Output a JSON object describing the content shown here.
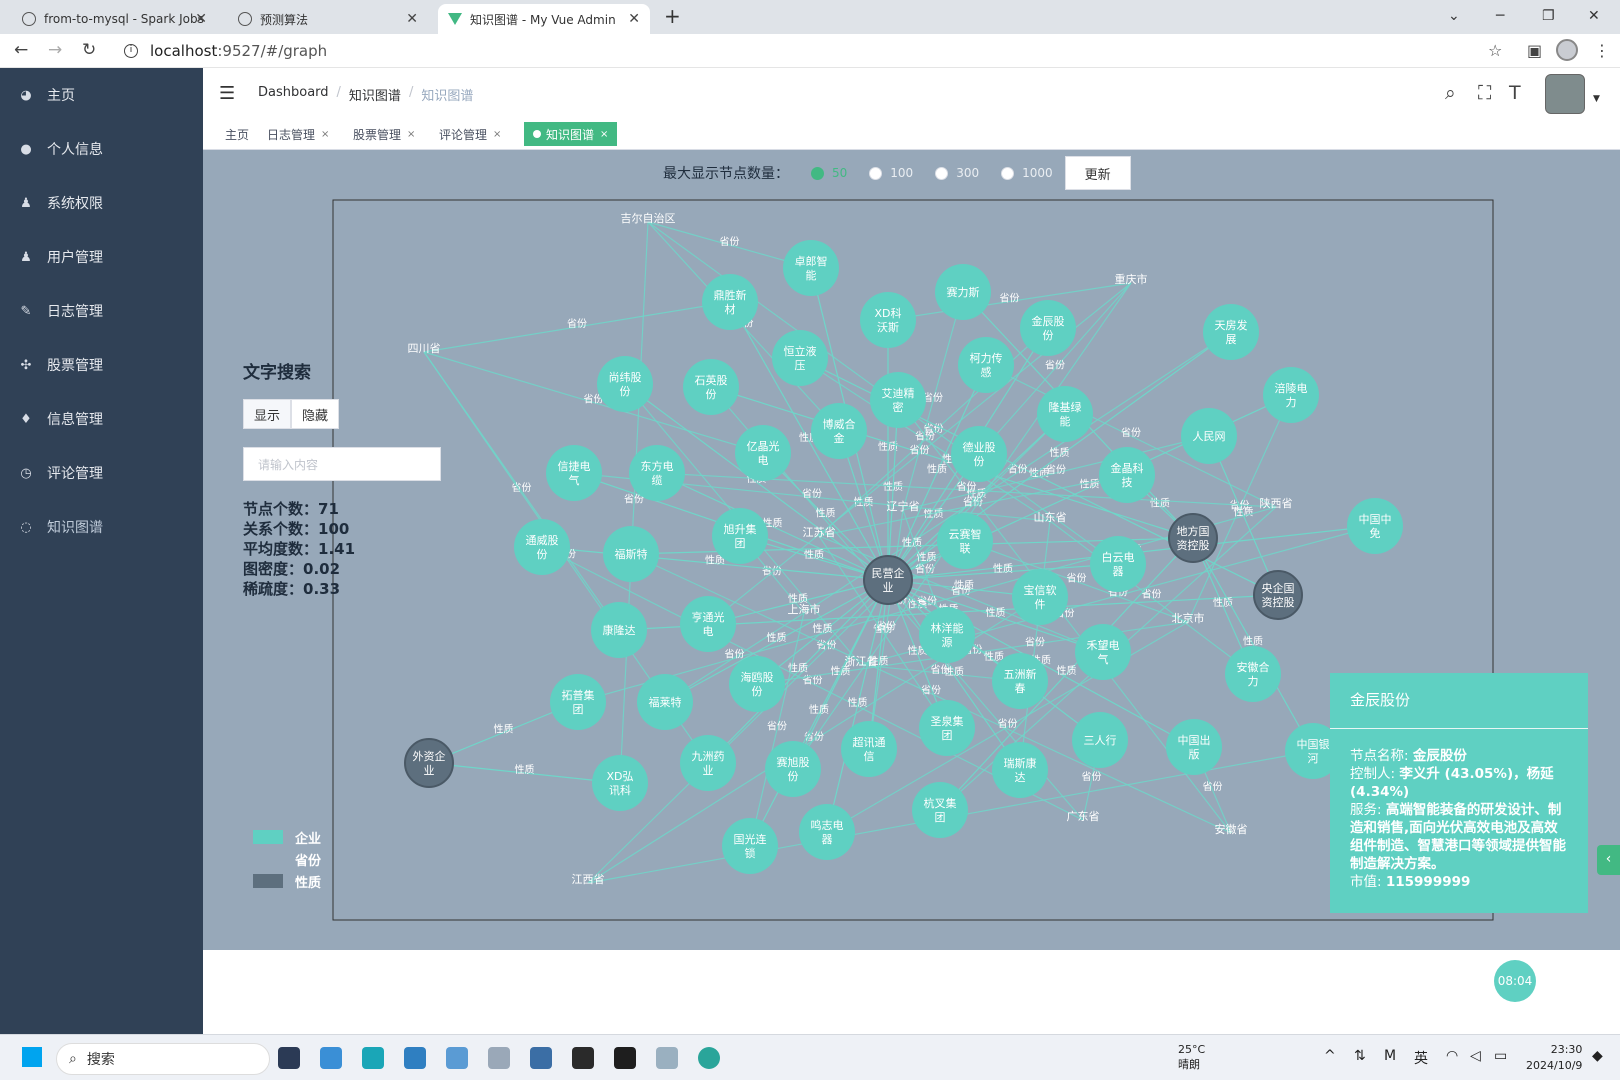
{
  "browser": {
    "tabs": [
      {
        "title": "from-to-mysql - Spark Jobs",
        "active": false
      },
      {
        "title": "预测算法",
        "active": false
      },
      {
        "title": "知识图谱 - My Vue Admin",
        "active": true
      }
    ],
    "url_host": "localhost",
    "url_rest": ":9527/#/graph"
  },
  "sidebar": {
    "items": [
      {
        "label": "主页",
        "icon": "dashboard-icon"
      },
      {
        "label": "个人信息",
        "icon": "user-icon"
      },
      {
        "label": "系统权限",
        "icon": "lock-user-icon"
      },
      {
        "label": "用户管理",
        "icon": "users-icon"
      },
      {
        "label": "日志管理",
        "icon": "pen-icon"
      },
      {
        "label": "股票管理",
        "icon": "move-icon"
      },
      {
        "label": "信息管理",
        "icon": "location-icon"
      },
      {
        "label": "评论管理",
        "icon": "clock-icon"
      },
      {
        "label": "知识图谱",
        "icon": "graph-icon"
      }
    ]
  },
  "header": {
    "breadcrumb": [
      "Dashboard",
      "知识图谱",
      "知识图谱"
    ]
  },
  "tagsview": {
    "tags": [
      {
        "label": "主页",
        "closable": false,
        "active": false
      },
      {
        "label": "日志管理",
        "closable": true,
        "active": false
      },
      {
        "label": "股票管理",
        "closable": true,
        "active": false
      },
      {
        "label": "评论管理",
        "closable": true,
        "active": false
      },
      {
        "label": "知识图谱",
        "closable": true,
        "active": true
      }
    ]
  },
  "graph_controls": {
    "label": "最大显示节点数量：",
    "options": [
      "50",
      "100",
      "300",
      "1000"
    ],
    "selected": "50",
    "update_button": "更新"
  },
  "search_panel": {
    "title": "文字搜索",
    "show_label": "显示",
    "hide_label": "隐藏",
    "placeholder": "请输入内容",
    "stats": [
      {
        "label": "节点个数：",
        "value": "71"
      },
      {
        "label": "关系个数：",
        "value": "100"
      },
      {
        "label": "平均度数：",
        "value": "1.41"
      },
      {
        "label": "图密度：",
        "value": "0.02"
      },
      {
        "label": "稀疏度：",
        "value": "0.33"
      }
    ]
  },
  "legend": [
    {
      "label": "企业",
      "color": "#5fd0c2"
    },
    {
      "label": "省份",
      "color": "#97a8b9"
    },
    {
      "label": "性质",
      "color": "#5d6f7e"
    }
  ],
  "graph": {
    "company_color": "#5fd0c2",
    "nature_color": "#5d6f7e",
    "edge_labels": {
      "province": "省份",
      "nature": "性质"
    },
    "companies": [
      "卓郎智能",
      "鼎胜新材",
      "XD科沃斯",
      "赛力斯",
      "金辰股份",
      "恒立液压",
      "柯力传感",
      "天房发展",
      "涪陵电力",
      "尚纬股份",
      "石英股份",
      "艾迪精密",
      "隆基绿能",
      "博威合金",
      "亿晶光电",
      "德业股份",
      "人民网",
      "金晶科技",
      "信捷电气",
      "东方电缆",
      "旭升集团",
      "云赛智联",
      "中国中免",
      "通威股份",
      "福斯特",
      "宝信软件",
      "白云电器",
      "康隆达",
      "亨通光电",
      "林洋能源",
      "禾望电气",
      "安徽合力",
      "拓普集团",
      "福莱特",
      "海鸥股份",
      "五洲新春",
      "三人行",
      "中国出版",
      "中国银河",
      "XD弘讯科",
      "九洲药业",
      "赛旭股份",
      "超讯通信",
      "圣泉集团",
      "瑞斯康达",
      "杭叉集团",
      "国光连锁",
      "鸣志电器"
    ],
    "natures": [
      "民营企业",
      "地方国资控股",
      "央企国资控股",
      "外资企业"
    ],
    "provinces": [
      "吉尔自治区",
      "四川省",
      "重庆市",
      "辽宁省",
      "江苏省",
      "山东省",
      "陕西省",
      "上海市",
      "北京市",
      "浙江省",
      "广东省",
      "安徽省",
      "江西省"
    ]
  },
  "info_card": {
    "title": "金辰股份",
    "name_label": "节点名称:",
    "name_value": "金辰股份",
    "controller_label": "控制人:",
    "controller_value": "李义升 (43.05%)，杨延 (4.34%)",
    "business_label": "服务:",
    "business_value": "高端智能装备的研发设计、制造和销售,面向光伏高效电池及高效组件制造、智慧港口等领域提供智能制造解决方案。",
    "market_label": "市值:",
    "market_value": "115999999"
  },
  "clock_badge": "08:04",
  "taskbar": {
    "search_label": "搜索",
    "temperature": "25°C",
    "weather": "晴朗",
    "ime": "英",
    "time": "23:30",
    "date": "2024/10/9"
  }
}
